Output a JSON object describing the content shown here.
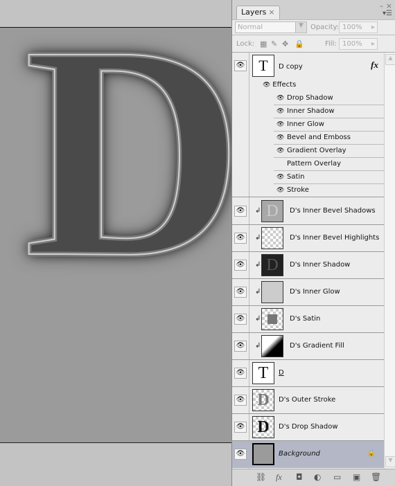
{
  "canvas": {
    "letter": "D"
  },
  "panel": {
    "tab_label": "Layers",
    "tab_close": "×",
    "window_controls": "– ×",
    "menu_icon": "▾☰",
    "blend_mode": "Normal",
    "opacity_label": "Opacity:",
    "opacity_value": "100%",
    "lock_label": "Lock:",
    "fill_label": "Fill:",
    "fill_value": "100%"
  },
  "layers": [
    {
      "name": "D copy",
      "thumb": "T",
      "fx": "fx",
      "visible": true
    },
    {
      "name": "D's Inner Bevel Shadows",
      "thumb": "D",
      "clipped": true,
      "visible": true
    },
    {
      "name": "D's Inner Bevel Highlights",
      "thumb": "",
      "clipped": true,
      "visible": true
    },
    {
      "name": "D's Inner Shadow",
      "thumb": "D",
      "clipped": true,
      "visible": true
    },
    {
      "name": "D's Inner Glow",
      "thumb": "",
      "clipped": true,
      "visible": true
    },
    {
      "name": "D's Satin",
      "thumb": "",
      "clipped": true,
      "visible": true
    },
    {
      "name": "D's Gradient Fill",
      "thumb": "",
      "clipped": true,
      "visible": true
    },
    {
      "name": "D",
      "thumb": "T",
      "visible": true
    },
    {
      "name": "D's Outer Stroke",
      "thumb": "D",
      "visible": true
    },
    {
      "name": "D's Drop Shadow",
      "thumb": "D",
      "visible": true
    },
    {
      "name": "Background",
      "thumb": "",
      "locked": true,
      "selected": true,
      "visible": true
    }
  ],
  "effects": {
    "label": "Effects",
    "items": [
      {
        "name": "Drop Shadow",
        "visible": true
      },
      {
        "name": "Inner Shadow",
        "visible": true
      },
      {
        "name": "Inner Glow",
        "visible": true
      },
      {
        "name": "Bevel and Emboss",
        "visible": true
      },
      {
        "name": "Gradient Overlay",
        "visible": true
      },
      {
        "name": "Pattern Overlay",
        "visible": false
      },
      {
        "name": "Satin",
        "visible": true
      },
      {
        "name": "Stroke",
        "visible": true
      }
    ]
  },
  "colors": {
    "selected_row": "#b4b7c6",
    "canvas": "#9b9b9b"
  }
}
